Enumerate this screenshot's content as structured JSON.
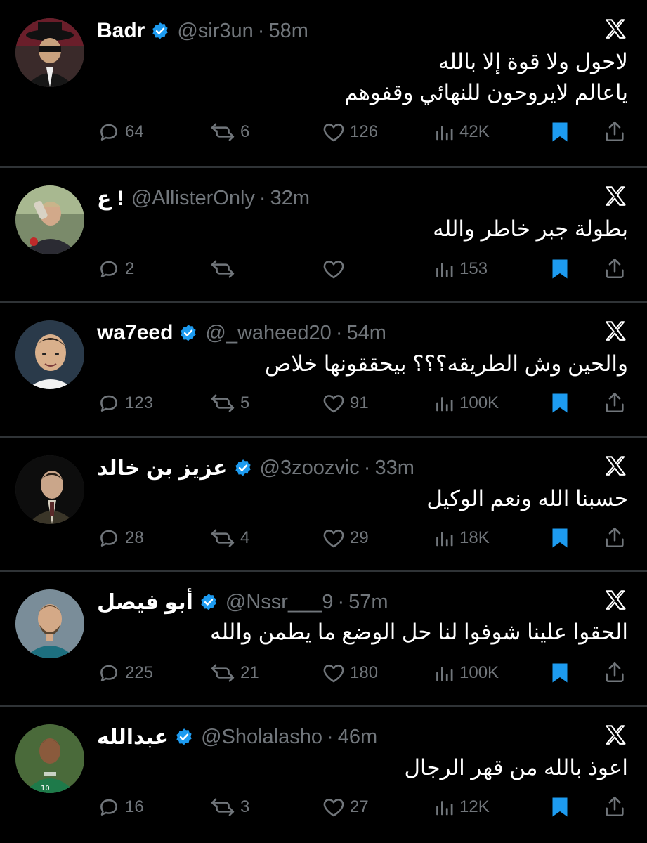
{
  "colors": {
    "background": "#000000",
    "text_primary": "#ffffff",
    "text_secondary": "#71767b",
    "divider": "#2f3336",
    "verified_badge": "#1d9bf0",
    "bookmark_active": "#1d9bf0"
  },
  "tweets": [
    {
      "name": "Badr",
      "verified": true,
      "handle": "@sir3un",
      "separator": "·",
      "time": "58m",
      "lines": [
        "لاحول ولا قوة إلا بالله",
        "ياعالم لايروحون للنهائي وقفوهم"
      ],
      "replies": "64",
      "reposts": "6",
      "likes": "126",
      "views": "42K",
      "bookmarked": true,
      "avatar_icon": "avatar-masked-figure"
    },
    {
      "name": "! ع",
      "verified": false,
      "handle": "@AllisterOnly",
      "separator": "·",
      "time": "32m",
      "lines": [
        "بطولة جبر خاطر والله"
      ],
      "replies": "2",
      "reposts": "",
      "likes": "",
      "views": "153",
      "bookmarked": true,
      "avatar_icon": "avatar-coach"
    },
    {
      "name": "wa7eed",
      "verified": true,
      "handle": "@_waheed20",
      "separator": "·",
      "time": "54m",
      "lines": [
        "والحين وش الطريقه؟؟؟ بيحققونها خلاص"
      ],
      "replies": "123",
      "reposts": "5",
      "likes": "91",
      "views": "100K",
      "bookmarked": true,
      "avatar_icon": "avatar-player"
    },
    {
      "name": "عزيز بن خالد",
      "verified": true,
      "handle": "@3zoozvic",
      "separator": "·",
      "time": "33m",
      "lines": [
        "حسبنا الله ونعم الوكيل"
      ],
      "replies": "28",
      "reposts": "4",
      "likes": "29",
      "views": "18K",
      "bookmarked": true,
      "avatar_icon": "avatar-man-suit"
    },
    {
      "name": "أبو فيصل",
      "verified": true,
      "handle": "@Nssr___9",
      "separator": "·",
      "time": "57m",
      "lines": [
        "الحقوا علينا شوفوا لنا حل الوضع ما يطمن والله"
      ],
      "replies": "225",
      "reposts": "21",
      "likes": "180",
      "views": "100K",
      "bookmarked": true,
      "avatar_icon": "avatar-bearded-player"
    },
    {
      "name": "عبدالله",
      "verified": true,
      "handle": "@Sholalasho",
      "separator": "·",
      "time": "46m",
      "lines": [
        "اعوذ بالله من قهر الرجال"
      ],
      "replies": "16",
      "reposts": "3",
      "likes": "27",
      "views": "12K",
      "bookmarked": true,
      "avatar_icon": "avatar-green-jersey-player"
    }
  ]
}
